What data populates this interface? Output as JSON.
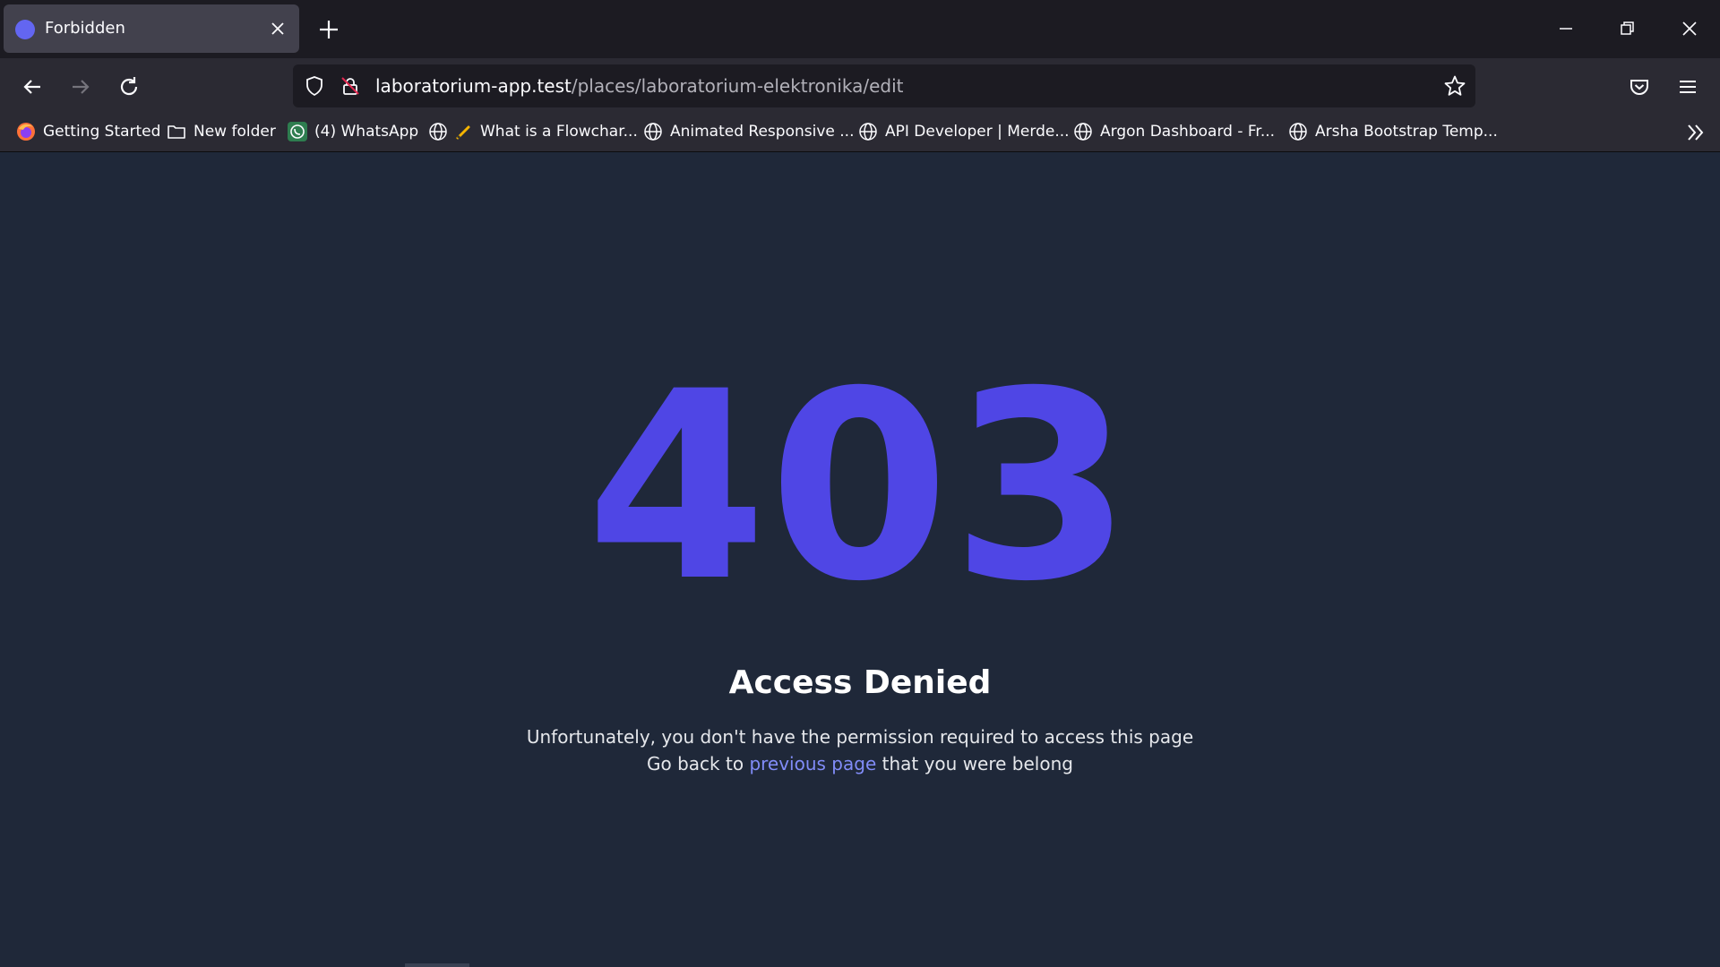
{
  "browser": {
    "tab": {
      "title": "Forbidden"
    },
    "address_bar": {
      "host": "laboratorium-app.test",
      "path": "/places/laboratorium-elektronika/edit"
    },
    "bookmarks": [
      {
        "label": "Getting Started",
        "icon": "firefox-icon"
      },
      {
        "label": "New folder",
        "icon": "folder-icon"
      },
      {
        "label": "(4) WhatsApp",
        "icon": "whatsapp-icon"
      },
      {
        "label": "What is a Flowchar...",
        "icon": "globe-icon"
      },
      {
        "label": "Animated Responsive ...",
        "icon": "globe-icon"
      },
      {
        "label": "API Developer | Merde...",
        "icon": "globe-icon"
      },
      {
        "label": "Argon Dashboard - Fr...",
        "icon": "globe-icon"
      },
      {
        "label": "Arsha Bootstrap Temp...",
        "icon": "globe-icon"
      }
    ]
  },
  "error_page": {
    "code": "403",
    "title": "Access Denied",
    "line1": "Unfortunately, you don't have the permission required to access this page",
    "line2_prefix": "Go back to ",
    "line2_link": "previous page",
    "line2_suffix": " that you were belong"
  },
  "colors": {
    "accent": "#4f46e5",
    "link": "#818cf8",
    "page_bg": "#1f2839"
  }
}
